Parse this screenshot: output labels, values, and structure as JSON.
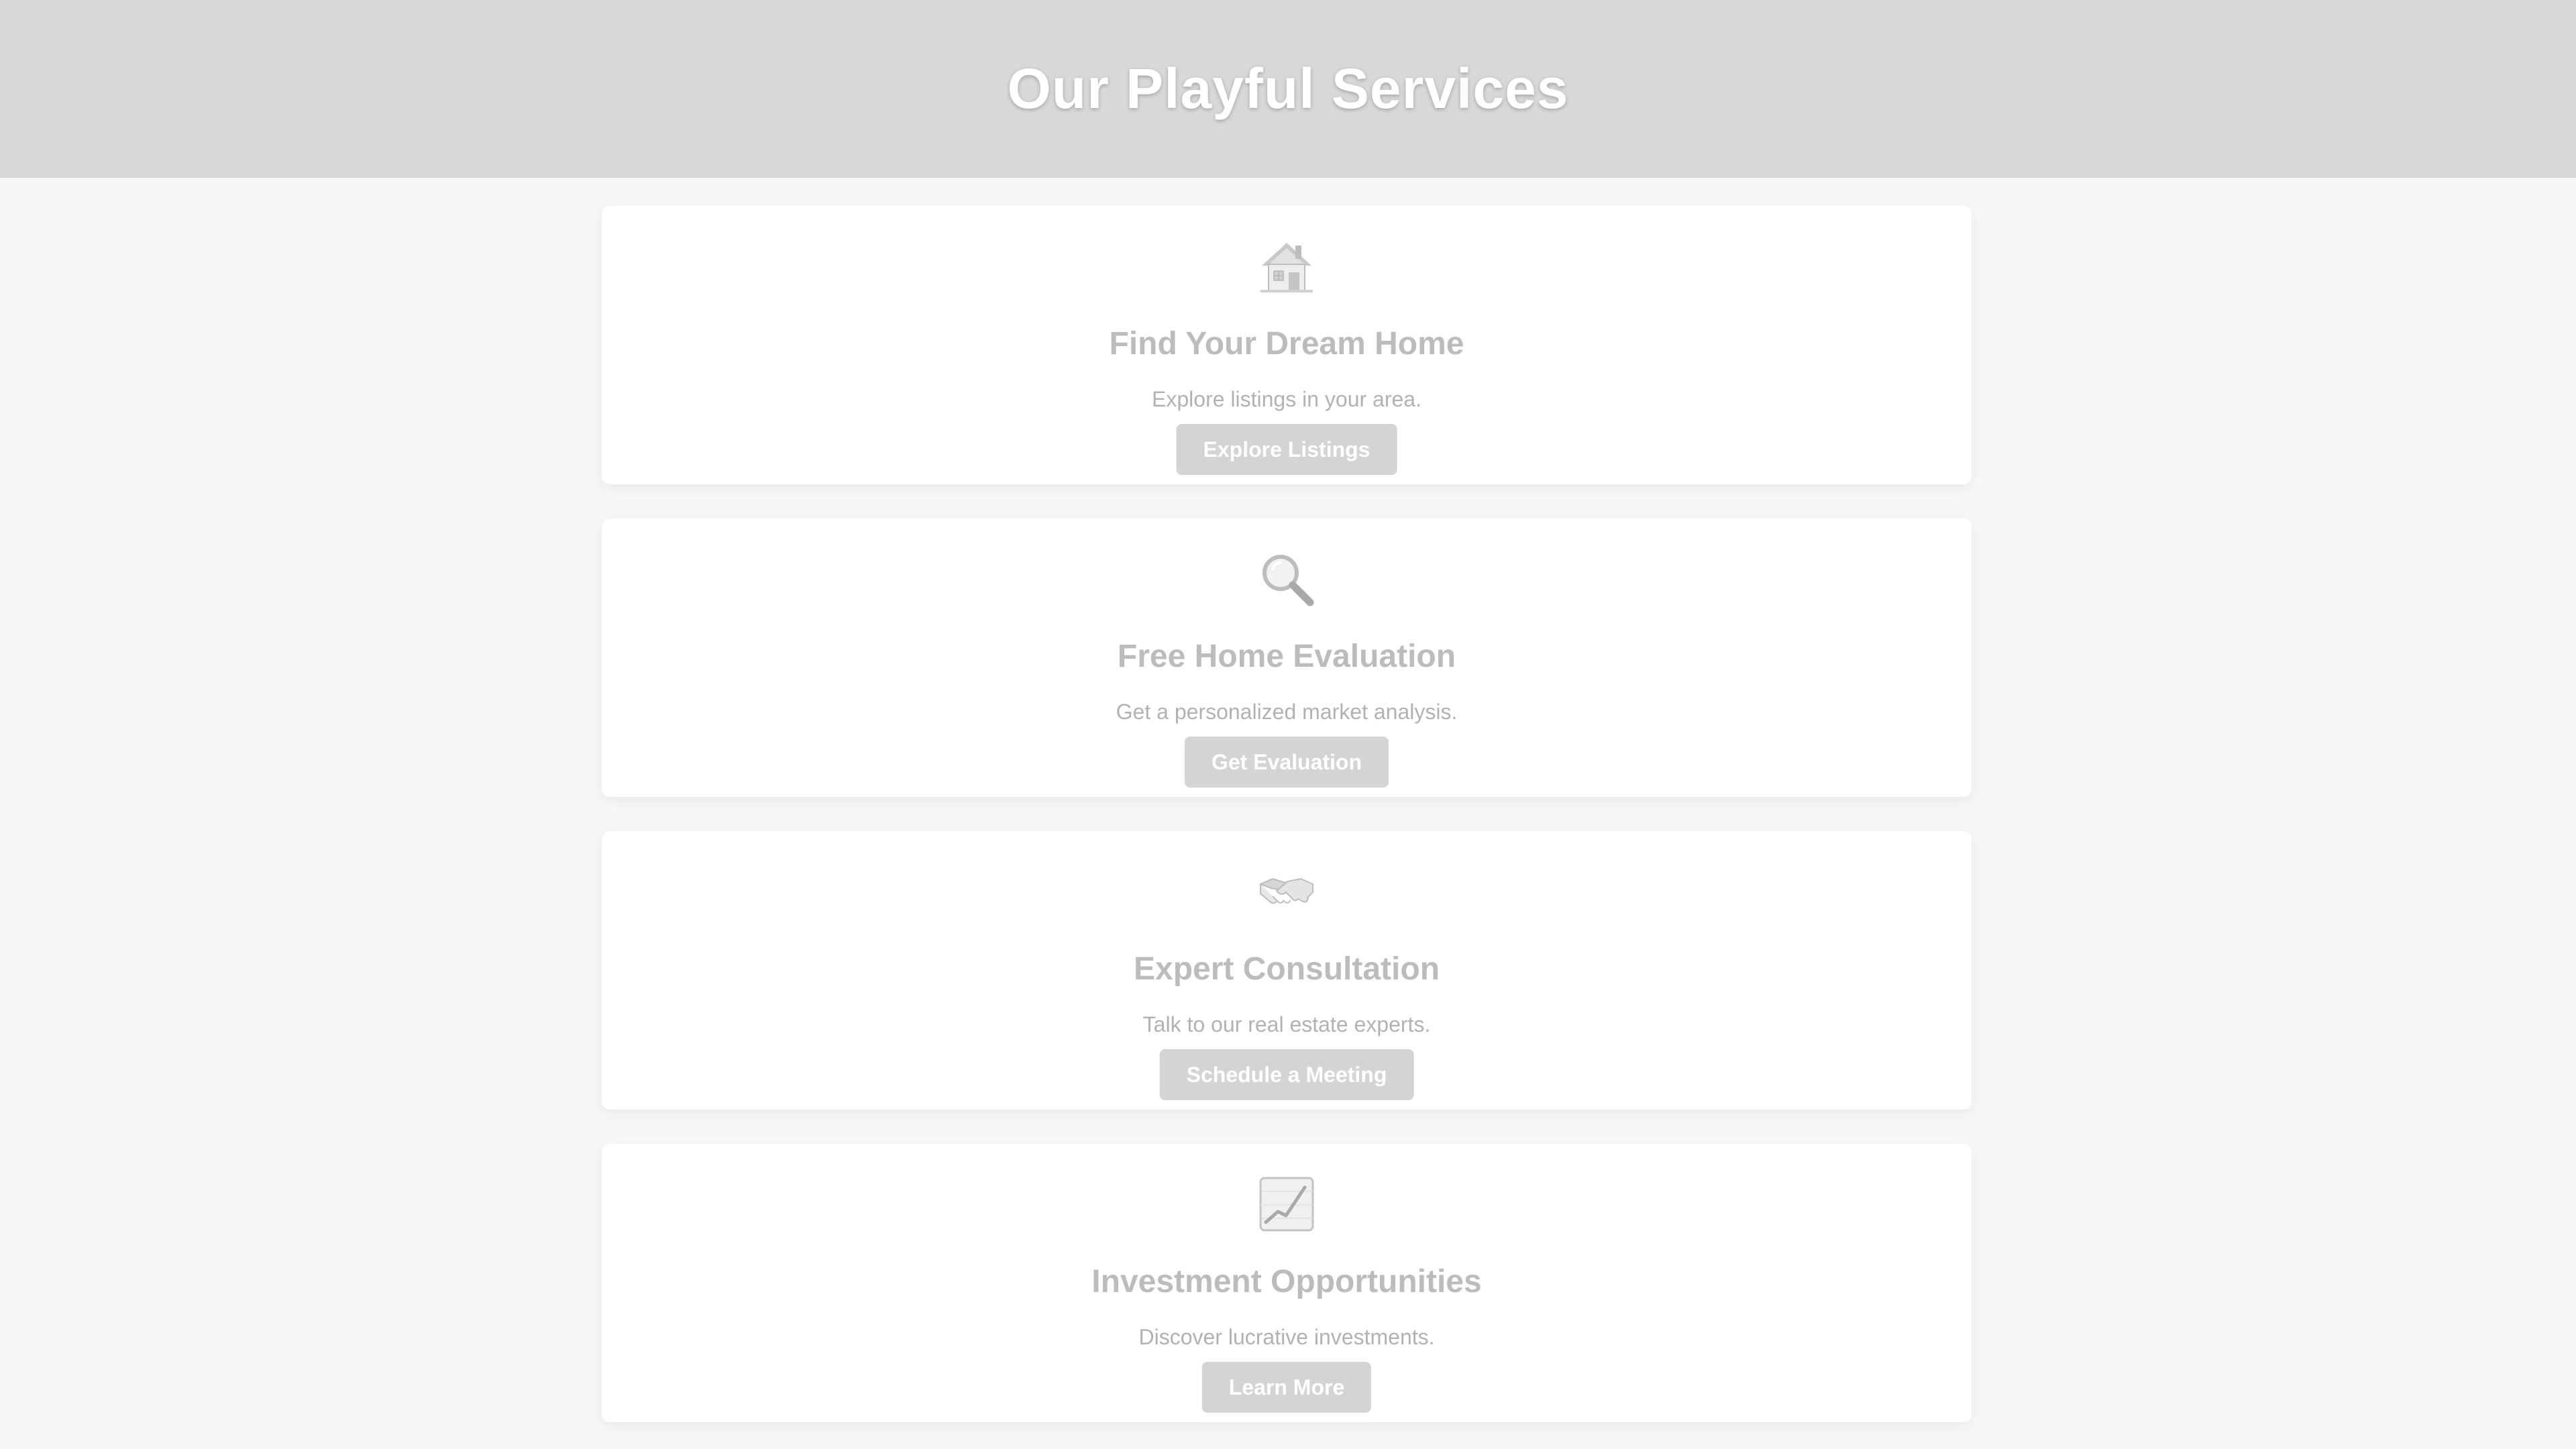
{
  "header": {
    "title": "Our Playful Services"
  },
  "services": [
    {
      "icon": "house-icon",
      "title": "Find Your Dream Home",
      "description": "Explore listings in your area.",
      "button_label": "Explore Listings"
    },
    {
      "icon": "magnifying-glass-icon",
      "title": "Free Home Evaluation",
      "description": "Get a personalized market analysis.",
      "button_label": "Get Evaluation"
    },
    {
      "icon": "handshake-icon",
      "title": "Expert Consultation",
      "description": "Talk to our real estate experts.",
      "button_label": "Schedule a Meeting"
    },
    {
      "icon": "chart-increasing-icon",
      "title": "Investment Opportunities",
      "description": "Discover lucrative investments.",
      "button_label": "Learn More"
    }
  ],
  "colors": {
    "header_background": "#d8d8d8",
    "button_background": "#d4d4d4",
    "title_text": "#bcbcbc",
    "description_text": "#b2b2b2"
  }
}
